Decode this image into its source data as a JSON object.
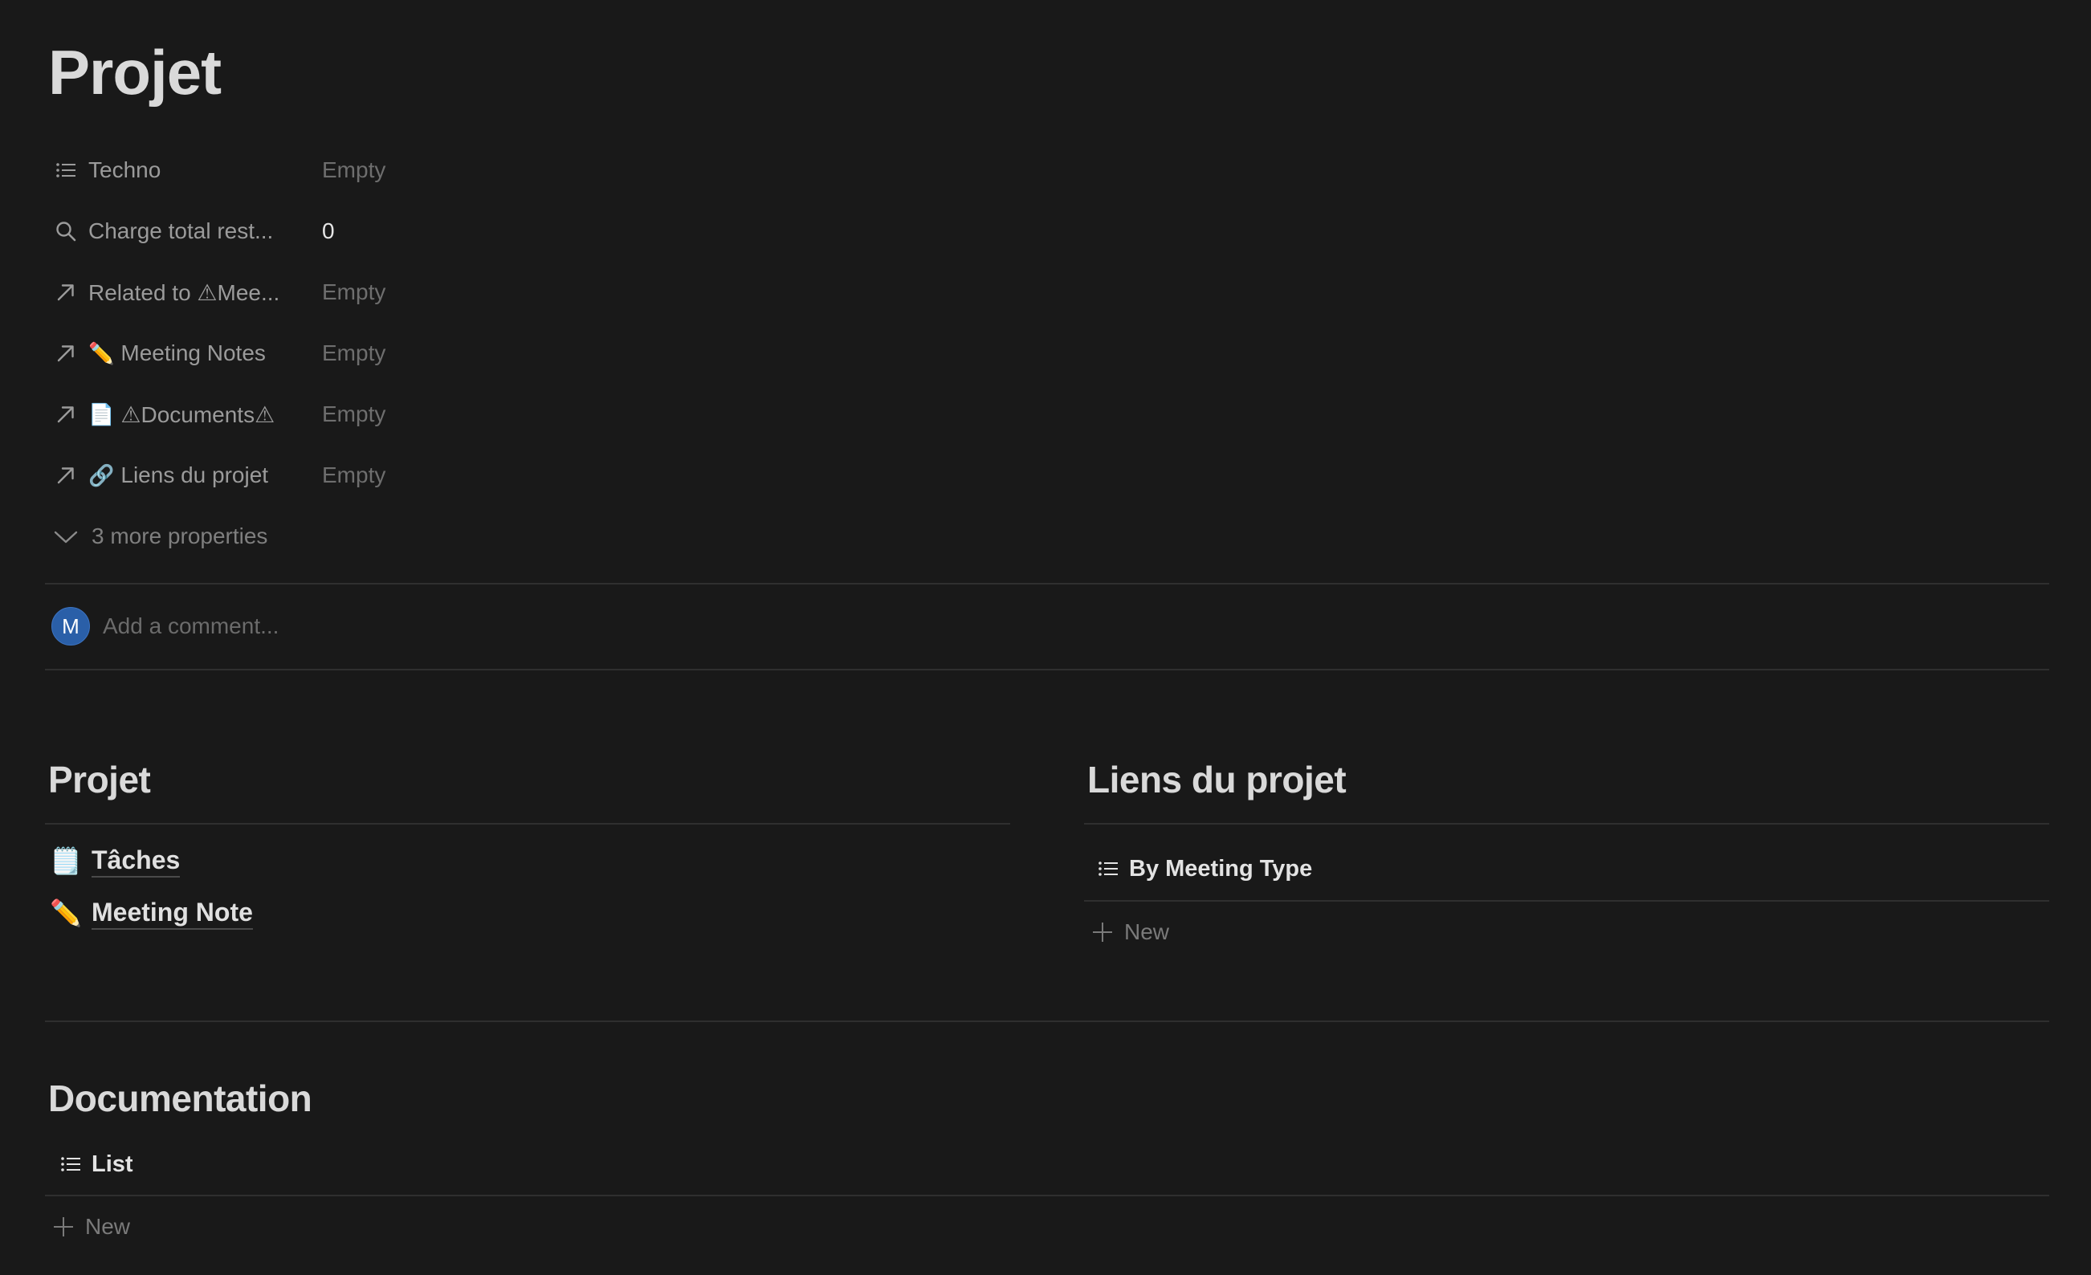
{
  "page": {
    "title": "Projet"
  },
  "properties": [
    {
      "icon": "list-icon",
      "label": "Techno",
      "value": "Empty",
      "filled": false
    },
    {
      "icon": "search-icon",
      "label": "Charge total rest...",
      "value": "0",
      "filled": true
    },
    {
      "icon": "relation-arrow-icon",
      "label": "Related to ⚠Mee...",
      "value": "Empty",
      "filled": false
    },
    {
      "icon": "relation-arrow-icon",
      "emoji": "✏️",
      "label": "Meeting Notes",
      "value": "Empty",
      "filled": false
    },
    {
      "icon": "relation-arrow-icon",
      "emoji": "📄",
      "label": "⚠Documents⚠",
      "value": "Empty",
      "filled": false
    },
    {
      "icon": "relation-arrow-icon",
      "emoji": "🔗",
      "label": "Liens du projet",
      "value": "Empty",
      "filled": false
    }
  ],
  "more_properties": {
    "icon": "chevron-down-icon",
    "label": "3 more properties"
  },
  "comment": {
    "avatar_initial": "M",
    "placeholder": "Add a comment..."
  },
  "sections": {
    "projet": {
      "title": "Projet",
      "links": [
        {
          "emoji": "🗒️",
          "label": "Tâches"
        },
        {
          "emoji": "✏️",
          "label": "Meeting Note"
        }
      ]
    },
    "liens": {
      "title": "Liens du projet",
      "view": {
        "icon": "list-icon",
        "label": "By Meeting Type"
      },
      "new_label": "New"
    },
    "documentation": {
      "title": "Documentation",
      "view": {
        "icon": "list-icon",
        "label": "List"
      },
      "new_label": "New"
    }
  },
  "colors": {
    "background": "#191919",
    "text": "#d4d4d4",
    "muted": "#6e6e6e",
    "divider": "#2f2f2f",
    "avatar": "#2a5fa8"
  }
}
